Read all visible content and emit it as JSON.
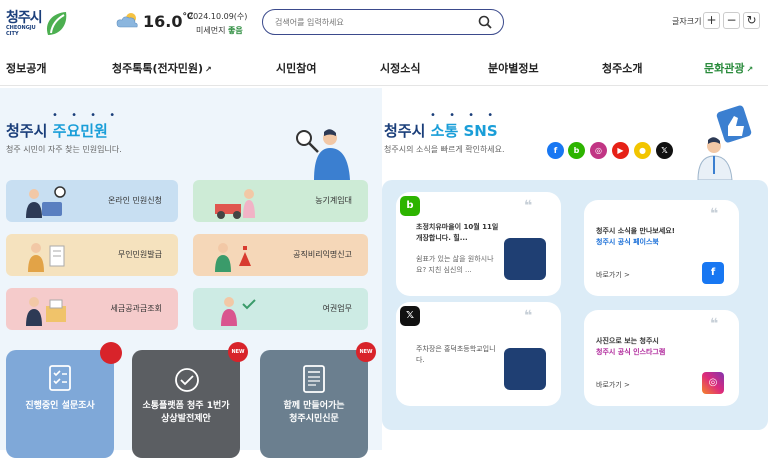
{
  "header": {
    "logo": {
      "ko": "청주시",
      "en_line1": "CHEONGJU",
      "en_line2": "CITY"
    },
    "weather": {
      "temp": "16.0",
      "unit": "℃",
      "date": "2024.10.09(수)",
      "dust_label": "미세먼지",
      "dust_value": "좋음"
    },
    "search": {
      "placeholder": "검색어를 입력하세요"
    },
    "font_size": {
      "label": "글자크기",
      "plus": "+",
      "minus": "−",
      "reset": "↻"
    }
  },
  "nav": {
    "items": [
      {
        "label": "정보공개"
      },
      {
        "label": "청주톡톡(전자민원)",
        "ext": "↗"
      },
      {
        "label": "시민참여"
      },
      {
        "label": "시정소식"
      },
      {
        "label": "분야별정보"
      },
      {
        "label": "청주소개"
      },
      {
        "label": "문화관광",
        "ext": "↗"
      }
    ],
    "culture_color": "#2a8b3c"
  },
  "civil": {
    "title_a": "청주시",
    "title_b": "주요민원",
    "subtitle": "청주 시민이 자주 찾는 민원입니다.",
    "dots": "• • • •",
    "tiles": [
      {
        "label": "온라인 민원신청",
        "color": "#c8dff2"
      },
      {
        "label": "농기계임대",
        "color": "#cdebd6"
      },
      {
        "label": "무인민원발급",
        "color": "#f5e2be"
      },
      {
        "label": "공직비리익명신고",
        "color": "#f5d7b8"
      },
      {
        "label": "세금공과금조회",
        "color": "#f5cbcb"
      },
      {
        "label": "여권업무",
        "color": "#cdebe4"
      }
    ],
    "cards": [
      {
        "label": "진행중인 설문조사",
        "badge": ""
      },
      {
        "label_line1": "소통플랫폼 청주 1번가",
        "label_line2": "상상발전제안",
        "badge": "NEW"
      },
      {
        "label_line1": "함께 만들어가는",
        "label_line2": "청주시민신문",
        "badge": "NEW"
      }
    ]
  },
  "sns": {
    "title_a": "청주시",
    "title_b": "소통 SNS",
    "subtitle": "청주시의 소식을 빠르게 확인하세요.",
    "dots": "• • • •",
    "channels": [
      {
        "name": "facebook-icon",
        "glyph": "f",
        "color": "#1877f2"
      },
      {
        "name": "blog-icon",
        "glyph": "b",
        "color": "#2db400"
      },
      {
        "name": "instagram-icon",
        "glyph": "◎",
        "color": "#c13584"
      },
      {
        "name": "youtube-icon",
        "glyph": "▶",
        "color": "#e62117"
      },
      {
        "name": "kakao-icon",
        "glyph": "●",
        "color": "#f2c500"
      },
      {
        "name": "x-icon",
        "glyph": "𝕏",
        "color": "#111111"
      }
    ],
    "posts": {
      "blog": {
        "icon": "b",
        "title": "초정치유마을이 10월 11일 개장합니다. 힐...",
        "body": "쉼표가 있는 삶을 원하시나요? 지친 심신의 ..."
      },
      "fb": {
        "line1": "청주시 소식을 만나보세요!",
        "line2": "청주시 공식 페이스북",
        "go": "바로가기 >"
      },
      "x": {
        "icon": "𝕏",
        "body": "주차장은 홍덕초등학교입니다."
      },
      "insta": {
        "line1": "사진으로 보는 청주시",
        "line2": "청주시 공식 인스타그램",
        "go": "바로가기 >"
      }
    }
  }
}
